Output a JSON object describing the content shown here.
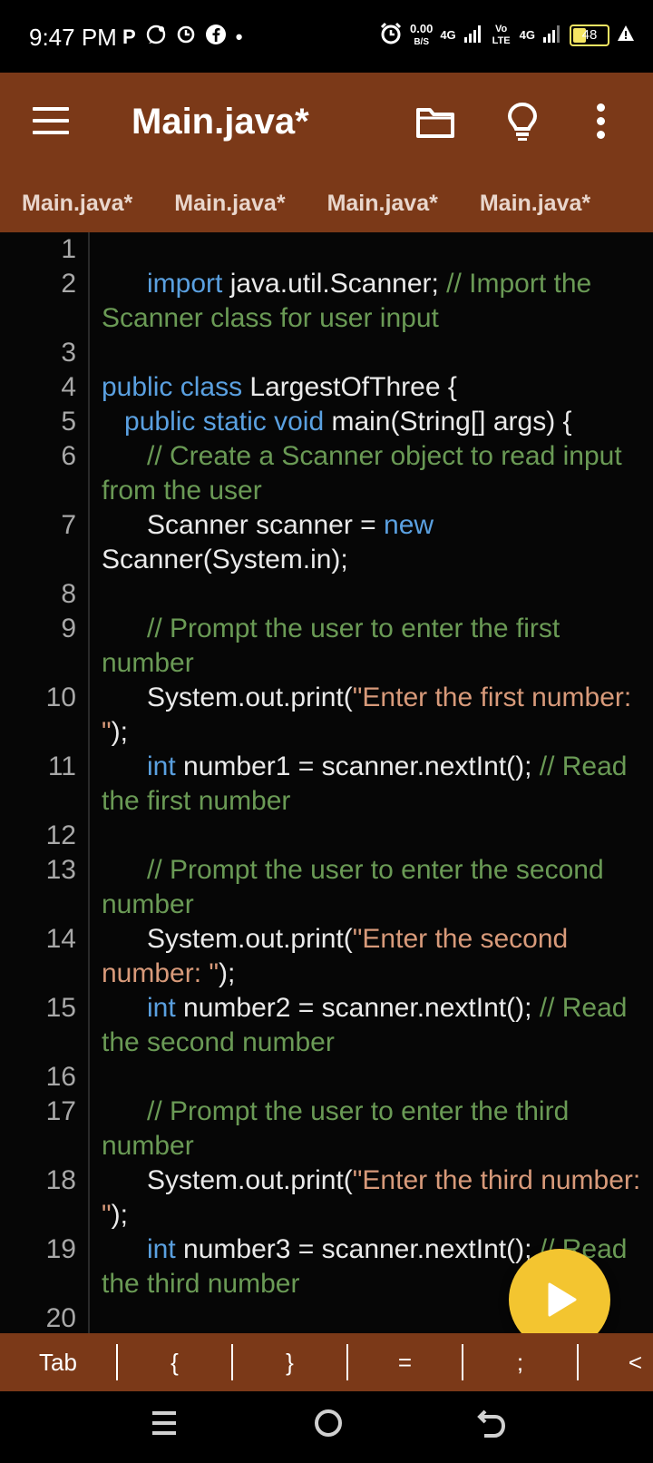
{
  "status_bar": {
    "time": "9:47 PM",
    "left_icons": [
      "p-icon",
      "whatsapp-icon",
      "clock-icon",
      "facebook-icon",
      "dot-icon"
    ],
    "net_speed_value": "0.00",
    "net_speed_unit": "B/S",
    "network_1": "4G",
    "volte": "Vo LTE",
    "network_2": "4G",
    "battery_level": "48"
  },
  "app_bar": {
    "title": "Main.java*"
  },
  "tabs": [
    {
      "label": "Main.java*"
    },
    {
      "label": "Main.java*"
    },
    {
      "label": "Main.java*"
    },
    {
      "label": "Main.java*"
    }
  ],
  "editor": {
    "lines": [
      {
        "no": "1"
      },
      {
        "no": "2"
      },
      {
        "no": "3"
      },
      {
        "no": "4"
      },
      {
        "no": "5"
      },
      {
        "no": "6"
      },
      {
        "no": "7"
      },
      {
        "no": "8"
      },
      {
        "no": "9"
      },
      {
        "no": "10"
      },
      {
        "no": "11"
      },
      {
        "no": "12"
      },
      {
        "no": "13"
      },
      {
        "no": "14"
      },
      {
        "no": "15"
      },
      {
        "no": "16"
      },
      {
        "no": "17"
      },
      {
        "no": "18"
      },
      {
        "no": "19"
      },
      {
        "no": "20"
      }
    ],
    "code": {
      "l2_kw": "import",
      "l2_text": " java.util.Scanner; ",
      "l2_cm": "// Import the Scanner class for user input",
      "l4_kw": "public class",
      "l4_text": " LargestOfThree {",
      "l5_kw": "public static void",
      "l5_text": " main(String[] args) {",
      "l6_cm": "// Create a Scanner object to read input from the user",
      "l7_text": "Scanner scanner = ",
      "l7_kw": "new",
      "l7_text2": " Scanner(System.in);",
      "l9_cm": "// Prompt the user to enter the first number",
      "l10_text": "System.out.print(",
      "l10_str": "\"Enter the first number: \"",
      "l10_text2": ");",
      "l11_kw": "int",
      "l11_text": " number1 = scanner.nextInt(); ",
      "l11_cm": "// Read the first number",
      "l13_cm": "// Prompt the user to enter the second number",
      "l14_text": "System.out.print(",
      "l14_str": "\"Enter the second number: \"",
      "l14_text2": ");",
      "l15_kw": "int",
      "l15_text": " number2 = scanner.nextInt(); ",
      "l15_cm": "// Read the second number",
      "l17_cm": "// Prompt the user to enter the third number",
      "l18_text": "System.out.print(",
      "l18_str": "\"Enter the third number: \"",
      "l18_text2": ");",
      "l19_kw": "int",
      "l19_text": " number3 = scanner.nextInt(); ",
      "l19_cm": "// Read the third number"
    }
  },
  "run_button": {
    "icon": "play-icon"
  },
  "symbol_bar": {
    "keys": [
      "Tab",
      "{",
      "}",
      "=",
      ";",
      "<"
    ]
  },
  "colors": {
    "app_bar": "#7b3918",
    "editor_bg": "#060606",
    "keyword": "#5aa0e0",
    "comment": "#6a9a55",
    "string": "#d89a7a",
    "fab": "#f3c530"
  }
}
